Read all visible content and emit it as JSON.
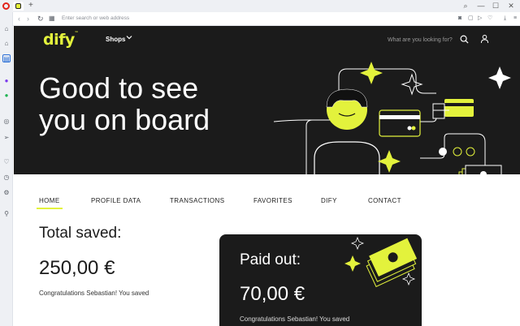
{
  "browser": {
    "new_tab": "+",
    "url_placeholder": "Enter search or web address",
    "win_minimize": "—",
    "win_maximize": "☐",
    "win_close": "✕"
  },
  "site": {
    "logo": "dify",
    "logo_tm": "™",
    "shops_label": "Shops",
    "search_placeholder": "What are you looking for?"
  },
  "hero": {
    "line1": "Good to see",
    "line2": "you on board"
  },
  "nav": {
    "items": [
      {
        "label": "HOME",
        "active": true
      },
      {
        "label": "PROFILE DATA",
        "active": false
      },
      {
        "label": "TRANSACTIONS",
        "active": false
      },
      {
        "label": "FAVORITES",
        "active": false
      },
      {
        "label": "DIFY",
        "active": false
      },
      {
        "label": "CONTACT",
        "active": false
      }
    ]
  },
  "saved": {
    "title": "Total saved:",
    "amount": "250,00 €",
    "text": "Congratulations Sebastian! You saved"
  },
  "paid": {
    "title": "Paid out:",
    "amount": "70,00 €",
    "text": "Congratulations Sebastian! You saved"
  },
  "colors": {
    "accent": "#e3f23c",
    "dark": "#1b1b1b",
    "browser_red": "#e2231a"
  }
}
